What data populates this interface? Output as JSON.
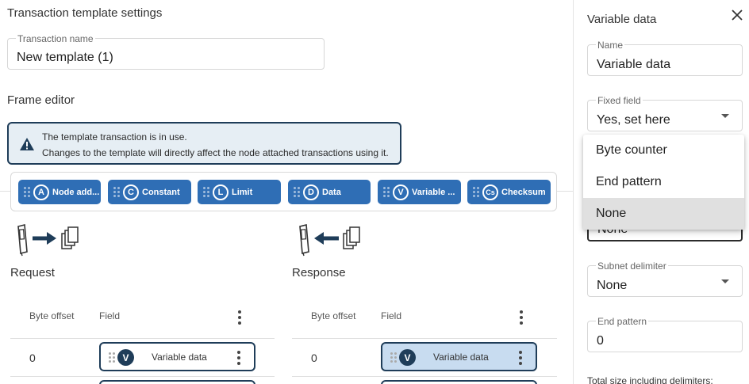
{
  "page": {
    "title": "Transaction template settings",
    "transaction_name_label": "Transaction name",
    "transaction_name_value": "New template (1)",
    "frame_editor_title": "Frame editor"
  },
  "alert": {
    "line1": "The template transaction is in use.",
    "line2": "Changes to the template will directly affect the node attached transactions using it."
  },
  "chips": [
    {
      "letter": "A",
      "label": "Node add..."
    },
    {
      "letter": "C",
      "label": "Constant"
    },
    {
      "letter": "L",
      "label": "Limit"
    },
    {
      "letter": "D",
      "label": "Data"
    },
    {
      "letter": "V",
      "label": "Variable ..."
    },
    {
      "letter": "Cs",
      "label": "Checksum"
    }
  ],
  "request": {
    "title": "Request",
    "col_offset": "Byte offset",
    "col_field": "Field",
    "rows": [
      {
        "offset": "0",
        "letter": "V",
        "field": "Variable data"
      }
    ]
  },
  "response": {
    "title": "Response",
    "col_offset": "Byte offset",
    "col_field": "Field",
    "rows": [
      {
        "offset": "0",
        "letter": "V",
        "field": "Variable data"
      }
    ]
  },
  "panel": {
    "title": "Variable data",
    "name_label": "Name",
    "name_value": "Variable data",
    "fixed_field_label": "Fixed field",
    "fixed_field_value": "Yes, set here",
    "hidden_field_value": "None",
    "subnet_label": "Subnet delimiter",
    "subnet_value": "None",
    "end_pattern_label": "End pattern",
    "end_pattern_value": "0",
    "footer_text": "Total size including delimiters:"
  },
  "dropdown": {
    "options": [
      "Byte counter",
      "End pattern",
      "None"
    ],
    "selected": "None"
  },
  "colors": {
    "chip_blue": "#2f6eb5",
    "navy": "#1f3d59",
    "alert_bg": "#e6eef4",
    "selected_row": "#c8dcf0"
  }
}
